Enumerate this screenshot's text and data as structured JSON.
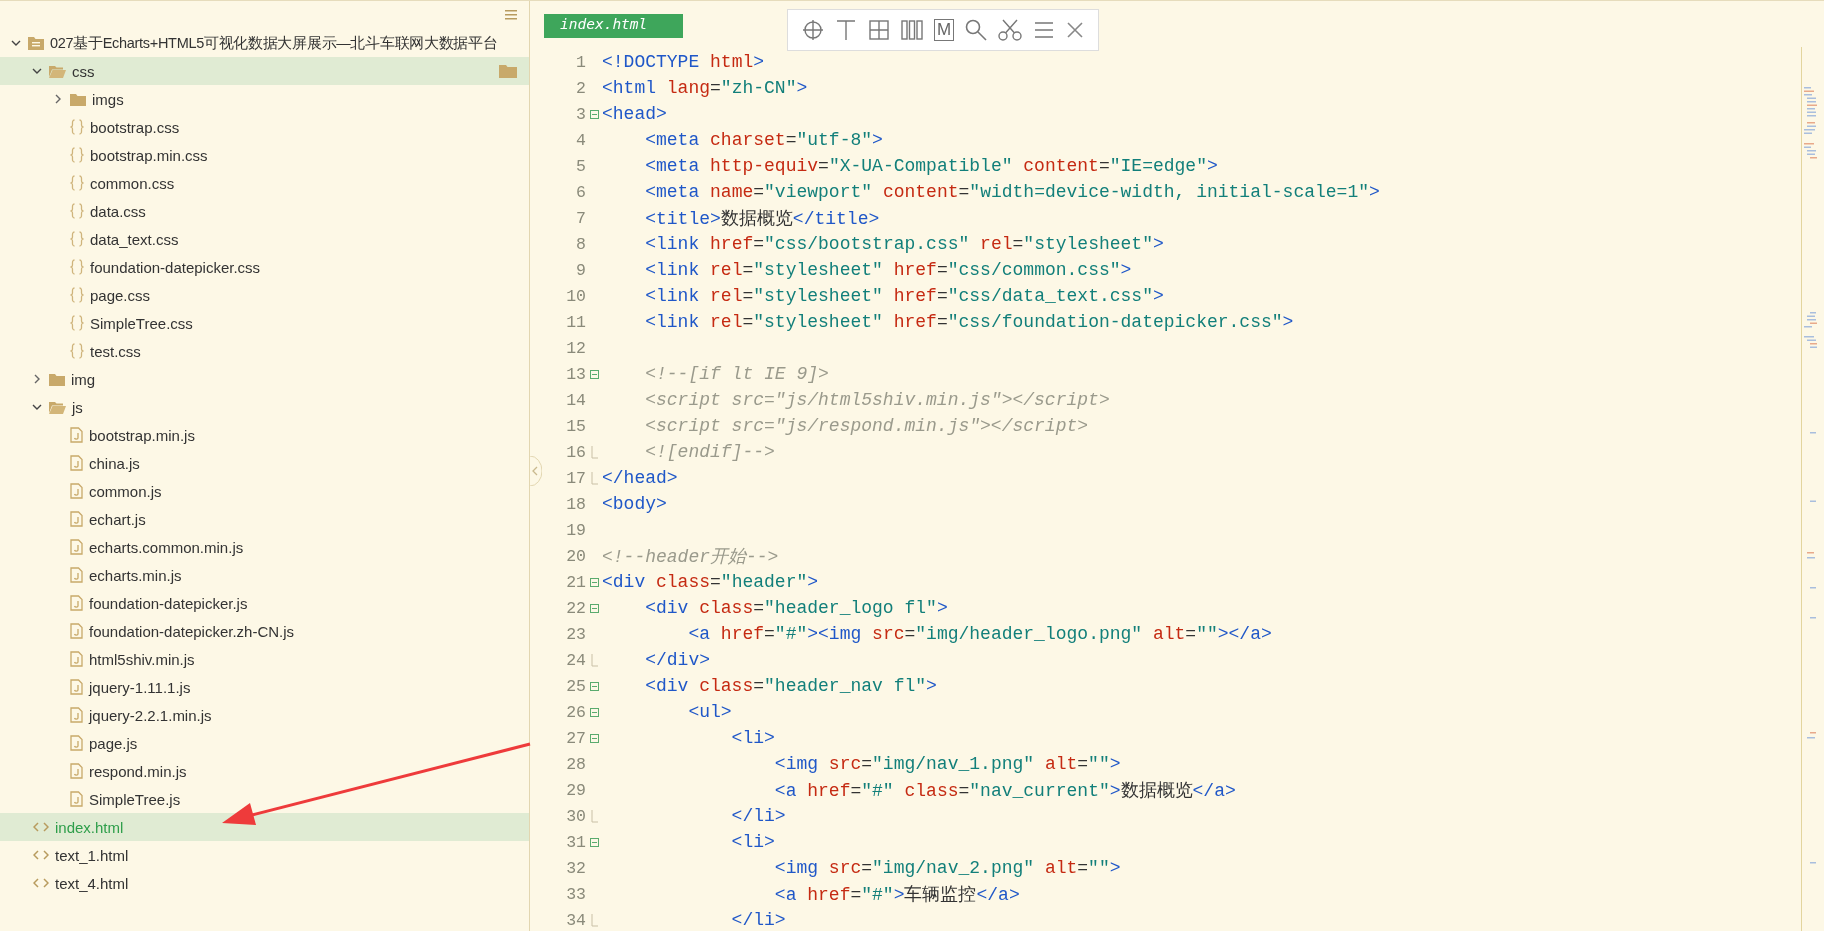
{
  "sidebar": {
    "tree": [
      {
        "label": "027基于Echarts+HTML5可视化数据大屏展示—北斗车联网大数据平台",
        "kind": "project",
        "expanded": true,
        "selected": false,
        "hovered": false,
        "children": [
          {
            "label": "css",
            "kind": "folder",
            "expanded": true,
            "selected": false,
            "hovered": true,
            "children": [
              {
                "label": "imgs",
                "kind": "folder",
                "expanded": false,
                "selected": false,
                "hovered": false
              },
              {
                "label": "bootstrap.css",
                "kind": "css",
                "selected": false,
                "hovered": false
              },
              {
                "label": "bootstrap.min.css",
                "kind": "css",
                "selected": false,
                "hovered": false
              },
              {
                "label": "common.css",
                "kind": "css",
                "selected": false,
                "hovered": false
              },
              {
                "label": "data.css",
                "kind": "css",
                "selected": false,
                "hovered": false
              },
              {
                "label": "data_text.css",
                "kind": "css",
                "selected": false,
                "hovered": false
              },
              {
                "label": "foundation-datepicker.css",
                "kind": "css",
                "selected": false,
                "hovered": false
              },
              {
                "label": "page.css",
                "kind": "css",
                "selected": false,
                "hovered": false
              },
              {
                "label": "SimpleTree.css",
                "kind": "css",
                "selected": false,
                "hovered": false
              },
              {
                "label": "test.css",
                "kind": "css",
                "selected": false,
                "hovered": false
              }
            ]
          },
          {
            "label": "img",
            "kind": "folder",
            "expanded": false,
            "selected": false,
            "hovered": false
          },
          {
            "label": "js",
            "kind": "folder",
            "expanded": true,
            "selected": false,
            "hovered": false,
            "children": [
              {
                "label": "bootstrap.min.js",
                "kind": "js",
                "selected": false,
                "hovered": false
              },
              {
                "label": "china.js",
                "kind": "js",
                "selected": false,
                "hovered": false
              },
              {
                "label": "common.js",
                "kind": "js",
                "selected": false,
                "hovered": false
              },
              {
                "label": "echart.js",
                "kind": "js",
                "selected": false,
                "hovered": false
              },
              {
                "label": "echarts.common.min.js",
                "kind": "js",
                "selected": false,
                "hovered": false
              },
              {
                "label": "echarts.min.js",
                "kind": "js",
                "selected": false,
                "hovered": false
              },
              {
                "label": "foundation-datepicker.js",
                "kind": "js",
                "selected": false,
                "hovered": false
              },
              {
                "label": "foundation-datepicker.zh-CN.js",
                "kind": "js",
                "selected": false,
                "hovered": false
              },
              {
                "label": "html5shiv.min.js",
                "kind": "js",
                "selected": false,
                "hovered": false
              },
              {
                "label": "jquery-1.11.1.js",
                "kind": "js",
                "selected": false,
                "hovered": false
              },
              {
                "label": "jquery-2.2.1.min.js",
                "kind": "js",
                "selected": false,
                "hovered": false
              },
              {
                "label": "page.js",
                "kind": "js",
                "selected": false,
                "hovered": false
              },
              {
                "label": "respond.min.js",
                "kind": "js",
                "selected": false,
                "hovered": false
              },
              {
                "label": "SimpleTree.js",
                "kind": "js",
                "selected": false,
                "hovered": false
              }
            ]
          },
          {
            "label": "index.html",
            "kind": "html",
            "selected": true,
            "hovered": false
          },
          {
            "label": "text_1.html",
            "kind": "html",
            "selected": false,
            "hovered": false
          },
          {
            "label": "text_4.html",
            "kind": "html",
            "selected": false,
            "hovered": false
          }
        ]
      }
    ]
  },
  "editor": {
    "tabs": [
      {
        "label": "index.html",
        "selected": true
      }
    ],
    "toolbar": [
      {
        "kind": "crosshair"
      },
      {
        "kind": "text-cursor"
      },
      {
        "kind": "grid"
      },
      {
        "kind": "columns"
      },
      {
        "kind": "markdown",
        "label": "M"
      },
      {
        "kind": "search"
      },
      {
        "kind": "scissors"
      },
      {
        "kind": "menu"
      },
      {
        "kind": "close"
      }
    ],
    "lines": [
      {
        "num": "1",
        "kind": "plain",
        "tokens": [
          {
            "kind": "tag",
            "text": "<!DOCTYPE "
          },
          {
            "kind": "attr",
            "text": "html"
          },
          {
            "kind": "tag",
            "text": ">"
          }
        ]
      },
      {
        "num": "2",
        "kind": "plain",
        "tokens": [
          {
            "kind": "tag",
            "text": "<html "
          },
          {
            "kind": "attr",
            "text": "lang"
          },
          {
            "kind": "eq",
            "text": "="
          },
          {
            "kind": "str",
            "text": "\"zh-CN\""
          },
          {
            "kind": "tag",
            "text": ">"
          }
        ]
      },
      {
        "num": "3",
        "kind": "fold-start",
        "tokens": [
          {
            "kind": "tag",
            "text": "<head>"
          }
        ]
      },
      {
        "num": "4",
        "kind": "plain",
        "tokens": [
          {
            "kind": "tag",
            "text": "    <meta "
          },
          {
            "kind": "attr",
            "text": "charset"
          },
          {
            "kind": "eq",
            "text": "="
          },
          {
            "kind": "str",
            "text": "\"utf-8\""
          },
          {
            "kind": "tag",
            "text": ">"
          }
        ]
      },
      {
        "num": "5",
        "kind": "plain",
        "tokens": [
          {
            "kind": "tag",
            "text": "    <meta "
          },
          {
            "kind": "attr",
            "text": "http-equiv"
          },
          {
            "kind": "eq",
            "text": "="
          },
          {
            "kind": "str",
            "text": "\"X-UA-Compatible\" "
          },
          {
            "kind": "attr",
            "text": "content"
          },
          {
            "kind": "eq",
            "text": "="
          },
          {
            "kind": "str",
            "text": "\"IE=edge\""
          },
          {
            "kind": "tag",
            "text": ">"
          }
        ]
      },
      {
        "num": "6",
        "kind": "plain",
        "tokens": [
          {
            "kind": "tag",
            "text": "    <meta "
          },
          {
            "kind": "attr",
            "text": "name"
          },
          {
            "kind": "eq",
            "text": "="
          },
          {
            "kind": "str",
            "text": "\"viewport\" "
          },
          {
            "kind": "attr",
            "text": "content"
          },
          {
            "kind": "eq",
            "text": "="
          },
          {
            "kind": "str",
            "text": "\"width=device-width, initial-scale=1\""
          },
          {
            "kind": "tag",
            "text": ">"
          }
        ]
      },
      {
        "num": "7",
        "kind": "plain",
        "tokens": [
          {
            "kind": "tag",
            "text": "    <title>"
          },
          {
            "kind": "text",
            "text": "数据概览"
          },
          {
            "kind": "tag",
            "text": "</title>"
          }
        ]
      },
      {
        "num": "8",
        "kind": "plain",
        "tokens": [
          {
            "kind": "tag",
            "text": "    <link "
          },
          {
            "kind": "attr",
            "text": "href"
          },
          {
            "kind": "eq",
            "text": "="
          },
          {
            "kind": "str",
            "text": "\"css/bootstrap.css\" "
          },
          {
            "kind": "attr",
            "text": "rel"
          },
          {
            "kind": "eq",
            "text": "="
          },
          {
            "kind": "str",
            "text": "\"stylesheet\""
          },
          {
            "kind": "tag",
            "text": ">"
          }
        ]
      },
      {
        "num": "9",
        "kind": "plain",
        "tokens": [
          {
            "kind": "tag",
            "text": "    <link "
          },
          {
            "kind": "attr",
            "text": "rel"
          },
          {
            "kind": "eq",
            "text": "="
          },
          {
            "kind": "str",
            "text": "\"stylesheet\" "
          },
          {
            "kind": "attr",
            "text": "href"
          },
          {
            "kind": "eq",
            "text": "="
          },
          {
            "kind": "str",
            "text": "\"css/common.css\""
          },
          {
            "kind": "tag",
            "text": ">"
          }
        ]
      },
      {
        "num": "10",
        "kind": "plain",
        "tokens": [
          {
            "kind": "tag",
            "text": "    <link "
          },
          {
            "kind": "attr",
            "text": "rel"
          },
          {
            "kind": "eq",
            "text": "="
          },
          {
            "kind": "str",
            "text": "\"stylesheet\" "
          },
          {
            "kind": "attr",
            "text": "href"
          },
          {
            "kind": "eq",
            "text": "="
          },
          {
            "kind": "str",
            "text": "\"css/data_text.css\""
          },
          {
            "kind": "tag",
            "text": ">"
          }
        ]
      },
      {
        "num": "11",
        "kind": "plain",
        "tokens": [
          {
            "kind": "tag",
            "text": "    <link "
          },
          {
            "kind": "attr",
            "text": "rel"
          },
          {
            "kind": "eq",
            "text": "="
          },
          {
            "kind": "str",
            "text": "\"stylesheet\" "
          },
          {
            "kind": "attr",
            "text": "href"
          },
          {
            "kind": "eq",
            "text": "="
          },
          {
            "kind": "str",
            "text": "\"css/foundation-datepicker.css\""
          },
          {
            "kind": "tag",
            "text": ">"
          }
        ]
      },
      {
        "num": "12",
        "kind": "plain"
      },
      {
        "num": "13",
        "kind": "fold-start",
        "tokens": [
          {
            "kind": "comment",
            "text": "    <!--[if lt IE 9]>"
          }
        ]
      },
      {
        "num": "14",
        "kind": "plain",
        "tokens": [
          {
            "kind": "comment",
            "text": "    <script src=\"js/html5shiv.min.js\"></script>"
          }
        ]
      },
      {
        "num": "15",
        "kind": "plain",
        "tokens": [
          {
            "kind": "comment",
            "text": "    <script src=\"js/respond.min.js\"></script>"
          }
        ]
      },
      {
        "num": "16",
        "kind": "fold-end",
        "tokens": [
          {
            "kind": "comment",
            "text": "    <![endif]-->"
          }
        ]
      },
      {
        "num": "17",
        "kind": "fold-end",
        "tokens": [
          {
            "kind": "tag",
            "text": "</head>"
          }
        ]
      },
      {
        "num": "18",
        "kind": "plain",
        "tokens": [
          {
            "kind": "tag",
            "text": "<body>"
          }
        ]
      },
      {
        "num": "19",
        "kind": "plain"
      },
      {
        "num": "20",
        "kind": "plain",
        "tokens": [
          {
            "kind": "comment",
            "text": "<!--header开始-->"
          }
        ]
      },
      {
        "num": "21",
        "kind": "fold-start",
        "tokens": [
          {
            "kind": "tag",
            "text": "<div "
          },
          {
            "kind": "attr",
            "text": "class"
          },
          {
            "kind": "eq",
            "text": "="
          },
          {
            "kind": "str",
            "text": "\"header\""
          },
          {
            "kind": "tag",
            "text": ">"
          }
        ]
      },
      {
        "num": "22",
        "kind": "fold-start",
        "tokens": [
          {
            "kind": "tag",
            "text": "    <div "
          },
          {
            "kind": "attr",
            "text": "class"
          },
          {
            "kind": "eq",
            "text": "="
          },
          {
            "kind": "str",
            "text": "\"header_logo fl\""
          },
          {
            "kind": "tag",
            "text": ">"
          }
        ]
      },
      {
        "num": "23",
        "kind": "plain",
        "tokens": [
          {
            "kind": "tag",
            "text": "        <a "
          },
          {
            "kind": "attr",
            "text": "href"
          },
          {
            "kind": "eq",
            "text": "="
          },
          {
            "kind": "str",
            "text": "\"#\""
          },
          {
            "kind": "tag",
            "text": "><img "
          },
          {
            "kind": "attr",
            "text": "src"
          },
          {
            "kind": "eq",
            "text": "="
          },
          {
            "kind": "str",
            "text": "\"img/header_logo.png\" "
          },
          {
            "kind": "attr",
            "text": "alt"
          },
          {
            "kind": "eq",
            "text": "="
          },
          {
            "kind": "str",
            "text": "\"\""
          },
          {
            "kind": "tag",
            "text": "></a>"
          }
        ]
      },
      {
        "num": "24",
        "kind": "fold-end",
        "tokens": [
          {
            "kind": "tag",
            "text": "    </div>"
          }
        ]
      },
      {
        "num": "25",
        "kind": "fold-start",
        "tokens": [
          {
            "kind": "tag",
            "text": "    <div "
          },
          {
            "kind": "attr",
            "text": "class"
          },
          {
            "kind": "eq",
            "text": "="
          },
          {
            "kind": "str",
            "text": "\"header_nav fl\""
          },
          {
            "kind": "tag",
            "text": ">"
          }
        ]
      },
      {
        "num": "26",
        "kind": "fold-start",
        "tokens": [
          {
            "kind": "tag",
            "text": "        <ul>"
          }
        ]
      },
      {
        "num": "27",
        "kind": "fold-start",
        "tokens": [
          {
            "kind": "tag",
            "text": "            <li>"
          }
        ]
      },
      {
        "num": "28",
        "kind": "plain",
        "tokens": [
          {
            "kind": "tag",
            "text": "                <img "
          },
          {
            "kind": "attr",
            "text": "src"
          },
          {
            "kind": "eq",
            "text": "="
          },
          {
            "kind": "str",
            "text": "\"img/nav_1.png\" "
          },
          {
            "kind": "attr",
            "text": "alt"
          },
          {
            "kind": "eq",
            "text": "="
          },
          {
            "kind": "str",
            "text": "\"\""
          },
          {
            "kind": "tag",
            "text": ">"
          }
        ]
      },
      {
        "num": "29",
        "kind": "plain",
        "tokens": [
          {
            "kind": "tag",
            "text": "                <a "
          },
          {
            "kind": "attr",
            "text": "href"
          },
          {
            "kind": "eq",
            "text": "="
          },
          {
            "kind": "str",
            "text": "\"#\" "
          },
          {
            "kind": "attr",
            "text": "class"
          },
          {
            "kind": "eq",
            "text": "="
          },
          {
            "kind": "str",
            "text": "\"nav_current\""
          },
          {
            "kind": "tag",
            "text": ">"
          },
          {
            "kind": "text",
            "text": "数据概览"
          },
          {
            "kind": "tag",
            "text": "</a>"
          }
        ]
      },
      {
        "num": "30",
        "kind": "fold-end",
        "tokens": [
          {
            "kind": "tag",
            "text": "            </li>"
          }
        ]
      },
      {
        "num": "31",
        "kind": "fold-start",
        "tokens": [
          {
            "kind": "tag",
            "text": "            <li>"
          }
        ]
      },
      {
        "num": "32",
        "kind": "plain",
        "tokens": [
          {
            "kind": "tag",
            "text": "                <img "
          },
          {
            "kind": "attr",
            "text": "src"
          },
          {
            "kind": "eq",
            "text": "="
          },
          {
            "kind": "str",
            "text": "\"img/nav_2.png\" "
          },
          {
            "kind": "attr",
            "text": "alt"
          },
          {
            "kind": "eq",
            "text": "="
          },
          {
            "kind": "str",
            "text": "\"\""
          },
          {
            "kind": "tag",
            "text": ">"
          }
        ]
      },
      {
        "num": "33",
        "kind": "plain",
        "tokens": [
          {
            "kind": "tag",
            "text": "                <a "
          },
          {
            "kind": "attr",
            "text": "href"
          },
          {
            "kind": "eq",
            "text": "="
          },
          {
            "kind": "str",
            "text": "\"#\""
          },
          {
            "kind": "tag",
            "text": ">"
          },
          {
            "kind": "text",
            "text": "车辆监控"
          },
          {
            "kind": "tag",
            "text": "</a>"
          }
        ]
      },
      {
        "num": "34",
        "kind": "fold-end",
        "tokens": [
          {
            "kind": "tag",
            "text": "            </li>"
          }
        ]
      }
    ]
  }
}
